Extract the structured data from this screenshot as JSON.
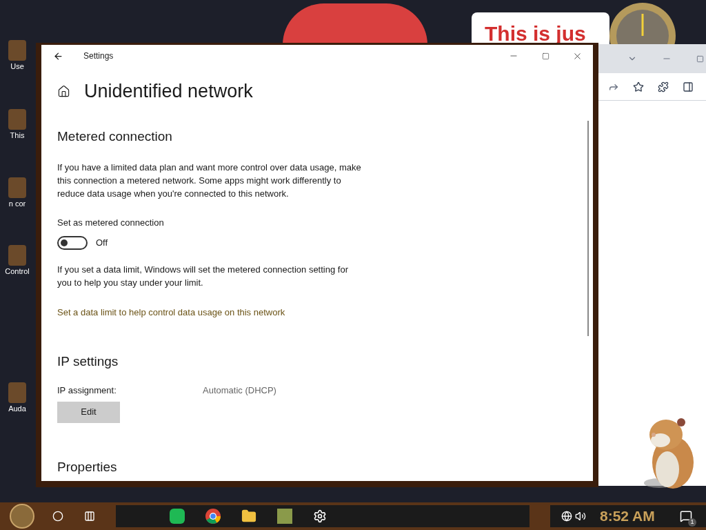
{
  "desktop": {
    "icons": [
      {
        "label": "Use"
      },
      {
        "label": "This"
      },
      {
        "label": "n cor"
      },
      {
        "label": "Control"
      },
      {
        "label": "Auda"
      }
    ],
    "banner": "This is jus"
  },
  "settings": {
    "title": "Settings",
    "page_title": "Unidentified network",
    "metered": {
      "heading": "Metered connection",
      "description": "If you have a limited data plan and want more control over data usage, make this connection a metered network. Some apps might work differently to reduce data usage when you're connected to this network.",
      "toggle_label": "Set as metered connection",
      "on": false,
      "state_text": "Off",
      "note": "If you set a data limit, Windows will set the metered connection setting for you to help you stay under your limit.",
      "link": "Set a data limit to help control data usage on this network"
    },
    "ip": {
      "heading": "IP settings",
      "label": "IP assignment:",
      "value": "Automatic (DHCP)",
      "button": "Edit"
    },
    "properties_heading": "Properties"
  },
  "taskbar": {
    "clock": "8:52 AM",
    "notification_count": "1"
  }
}
